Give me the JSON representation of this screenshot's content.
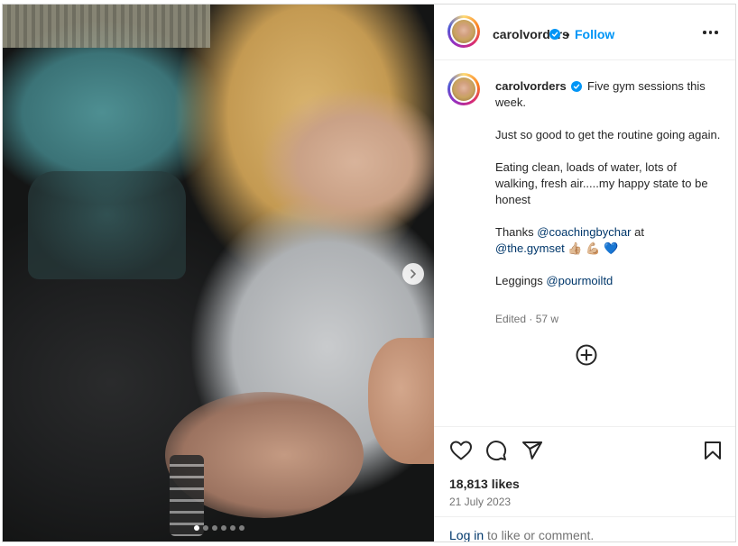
{
  "post": {
    "username": "carolvorders",
    "follow_label": "Follow",
    "separator": "•",
    "caption": {
      "username": "carolvorders",
      "line1": "Five gym sessions this week.",
      "line2": "Just so good to get the routine going again.",
      "line3": "Eating clean, loads of water, lots of walking, fresh air.....my happy state to be honest",
      "thanks_prefix": "Thanks ",
      "mention_coach": "@coachingbychar",
      "at_word": " at",
      "mention_gym": "@the.gymset",
      "emojis": "👍🏼 💪🏼 💙",
      "leggings_prefix": "Leggings ",
      "mention_leggings": "@pourmoiltd"
    },
    "meta": "Edited · 57 w",
    "likes": "18,813 likes",
    "date": "21 July 2023",
    "login_link": "Log in",
    "login_suffix": " to like or comment."
  },
  "carousel": {
    "slide_count": 6,
    "active_index": 0
  },
  "icons": {
    "verified": "verified-badge-icon",
    "more": "more-options-icon",
    "next": "chevron-right-icon",
    "add": "add-comment-icon",
    "like": "heart-icon",
    "comment": "comment-icon",
    "share": "share-icon",
    "save": "bookmark-icon"
  },
  "colors": {
    "accent": "#0095f6",
    "link": "#00376b",
    "muted": "#737373"
  }
}
